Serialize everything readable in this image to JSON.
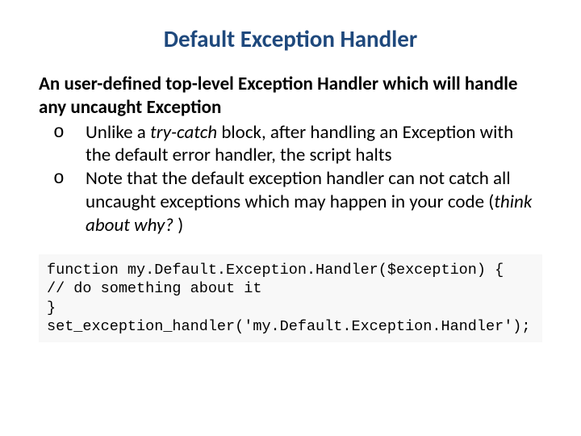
{
  "title": "Default Exception Handler",
  "lead": "An user-defined top-level Exception Handler which will handle any uncaught Exception",
  "bullets": [
    {
      "marker": "o",
      "pre": "Unlike a ",
      "em": "try-catch",
      "post": " block, after handling an Exception with the default error handler, the script halts"
    },
    {
      "marker": "o",
      "pre": "Note that the default exception handler can not catch all uncaught exceptions which may happen in your code (",
      "em": "think about why? ",
      "post": ")"
    }
  ],
  "code": "function my.Default.Exception.Handler($exception) {\n// do something about it\n}\nset_exception_handler('my.Default.Exception.Handler');"
}
